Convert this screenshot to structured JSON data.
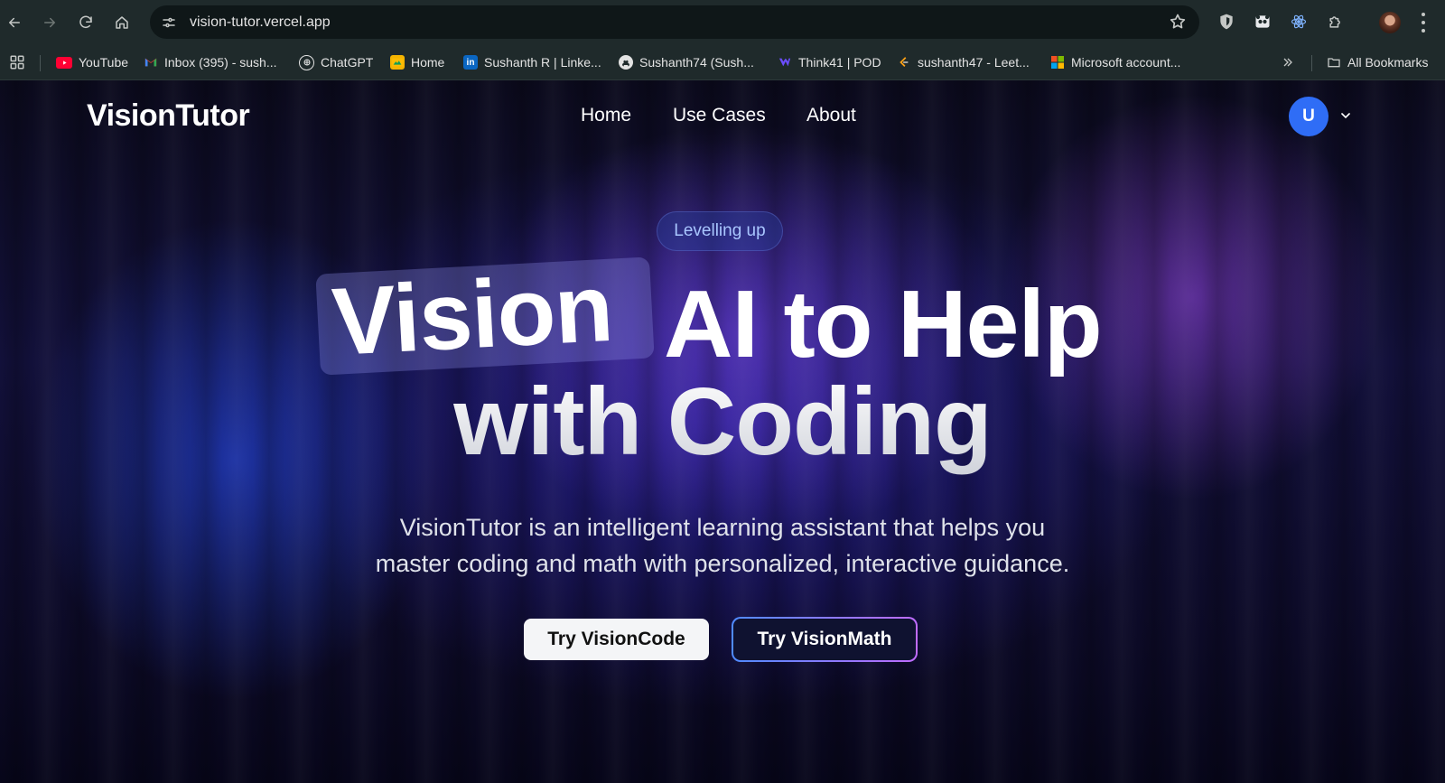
{
  "browser": {
    "url": "vision-tutor.vercel.app",
    "bookmarks": [
      {
        "label": "YouTube",
        "icon": "youtube-icon",
        "color": "#ff0033"
      },
      {
        "label": "Inbox (395) - sush...",
        "icon": "gmail-icon",
        "color": "#ea4335"
      },
      {
        "label": "ChatGPT",
        "icon": "chatgpt-icon",
        "color": "#ffffff"
      },
      {
        "label": "Home",
        "icon": "home-app-icon",
        "color": "#f4b400"
      },
      {
        "label": "Sushanth R | Linke...",
        "icon": "linkedin-icon",
        "color": "#0a66c2"
      },
      {
        "label": "Sushanth74 (Sush...",
        "icon": "github-icon",
        "color": "#ffffff"
      },
      {
        "label": "Think41 | POD",
        "icon": "think41-icon",
        "color": "#6b4dff"
      },
      {
        "label": "sushanth47 - Leet...",
        "icon": "leetcode-icon",
        "color": "#ffa116"
      },
      {
        "label": "Microsoft account...",
        "icon": "microsoft-icon",
        "color": "#f25022"
      }
    ],
    "all_bookmarks_label": "All Bookmarks"
  },
  "site": {
    "logo": "VisionTutor",
    "nav": [
      "Home",
      "Use Cases",
      "About"
    ],
    "avatar_initial": "U",
    "accent": "#2f6df6"
  },
  "hero": {
    "badge": "Levelling up",
    "headline_highlight": "Vision",
    "headline_rest_line1": "AI to Help",
    "headline_line2": "with Coding",
    "subtitle_line1": "VisionTutor is an intelligent learning assistant that helps you",
    "subtitle_line2": "master coding and math with personalized, interactive guidance.",
    "primary_cta": "Try VisionCode",
    "secondary_cta": "Try VisionMath"
  }
}
